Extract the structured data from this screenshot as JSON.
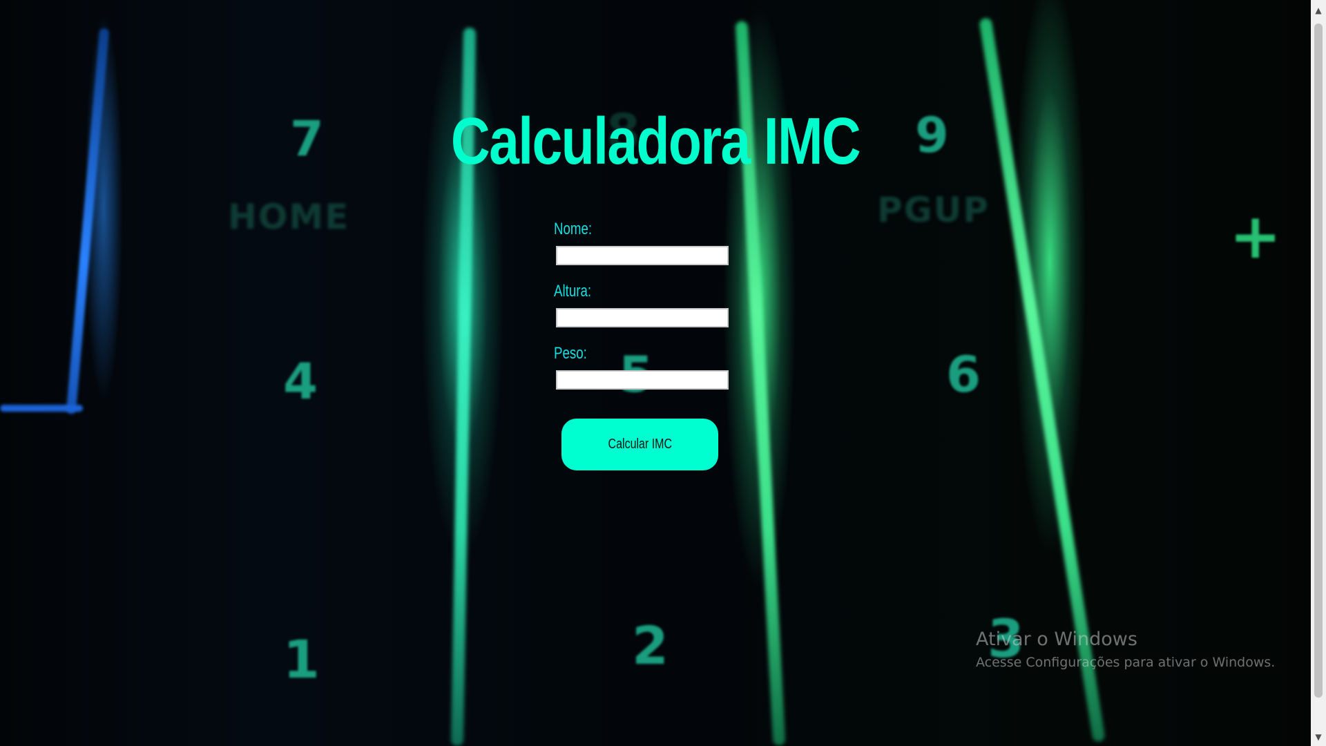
{
  "page": {
    "title": "Calculadora IMC"
  },
  "form": {
    "fields": [
      {
        "label": "Nome:",
        "value": ""
      },
      {
        "label": "Altura:",
        "value": ""
      },
      {
        "label": "Peso:",
        "value": ""
      }
    ],
    "submit_label": "Calcular IMC"
  },
  "background": {
    "keys": [
      "7",
      "8",
      "9",
      "4",
      "5",
      "6",
      "1",
      "2",
      "3",
      "+"
    ],
    "key_sublabels": [
      "HOME",
      "PGUP"
    ]
  },
  "watermark": {
    "title": "Ativar o Windows",
    "subtitle": "Acesse Configurações para ativar o Windows."
  },
  "colors": {
    "accent": "#00ffcc",
    "label": "#12e0e0",
    "button": "#00ffd0"
  },
  "icons": {
    "scroll_up": "triangle-up-icon",
    "scroll_down": "triangle-down-icon"
  }
}
